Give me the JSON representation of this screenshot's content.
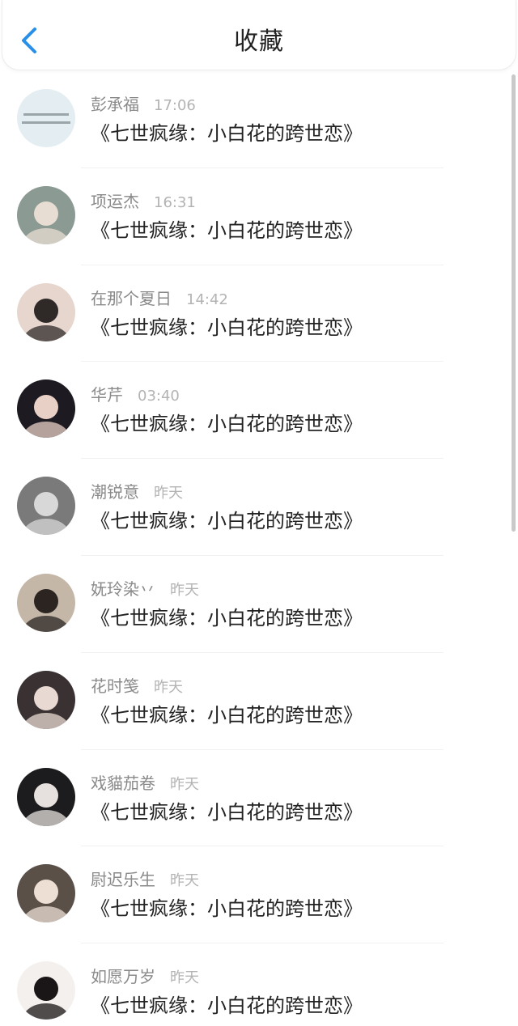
{
  "header": {
    "title": "收藏",
    "back_icon": "chevron-left-icon",
    "back_color": "#2a8fe8"
  },
  "items": [
    {
      "name": "彭承福",
      "time": "17:06",
      "content": "《七世疯缘：小白花的跨世恋》",
      "avatar_bg": "#e4eef2",
      "avatar_fg": "#c9d8de"
    },
    {
      "name": "项运杰",
      "time": "16:31",
      "content": "《七世疯缘：小白花的跨世恋》",
      "avatar_bg": "#8b9a93",
      "avatar_fg": "#e8ddd2"
    },
    {
      "name": "在那个夏日",
      "time": "14:42",
      "content": "《七世疯缘：小白花的跨世恋》",
      "avatar_bg": "#e6d6ce",
      "avatar_fg": "#2f2a28"
    },
    {
      "name": "华芹",
      "time": "03:40",
      "content": "《七世疯缘：小白花的跨世恋》",
      "avatar_bg": "#1d1a22",
      "avatar_fg": "#e8d0c6"
    },
    {
      "name": "潮锐意",
      "time": "昨天",
      "content": "《七世疯缘：小白花的跨世恋》",
      "avatar_bg": "#7a7a7a",
      "avatar_fg": "#d8d8d8"
    },
    {
      "name": "妩玲染丷",
      "time": "昨天",
      "content": "《七世疯缘：小白花的跨世恋》",
      "avatar_bg": "#c4b7a8",
      "avatar_fg": "#2b2421"
    },
    {
      "name": "花时笺",
      "time": "昨天",
      "content": "《七世疯缘：小白花的跨世恋》",
      "avatar_bg": "#3a3232",
      "avatar_fg": "#e9d9d3"
    },
    {
      "name": "戏貓茄卷",
      "time": "昨天",
      "content": "《七世疯缘：小白花的跨世恋》",
      "avatar_bg": "#1c1c1e",
      "avatar_fg": "#e6e0de"
    },
    {
      "name": "尉迟乐生",
      "time": "昨天",
      "content": "《七世疯缘：小白花的跨世恋》",
      "avatar_bg": "#5a5048",
      "avatar_fg": "#eedfd4"
    },
    {
      "name": "如愿万岁",
      "time": "昨天",
      "content": "《七世疯缘：小白花的跨世恋》",
      "avatar_bg": "#f4f0ee",
      "avatar_fg": "#1a1516"
    }
  ]
}
